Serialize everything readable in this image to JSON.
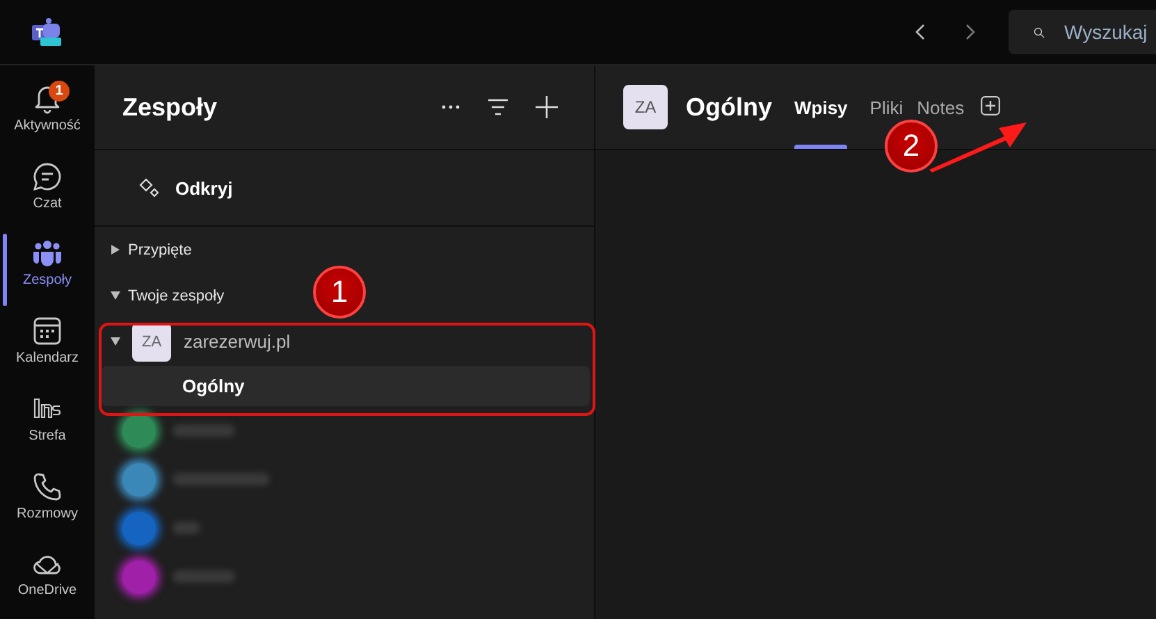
{
  "top_bar": {
    "search": {
      "placeholder": "Wyszukaj"
    }
  },
  "rail": [
    {
      "kind": "bell",
      "label": "Aktywność",
      "selected": false,
      "badge": "1"
    },
    {
      "kind": "chat",
      "label": "Czat",
      "selected": false
    },
    {
      "kind": "teams",
      "label": "Zespoły",
      "selected": true
    },
    {
      "kind": "calendar",
      "label": "Kalendarz",
      "selected": false
    },
    {
      "kind": "app",
      "label": "Strefa",
      "selected": false
    },
    {
      "kind": "phone",
      "label": "Rozmowy",
      "selected": false
    },
    {
      "kind": "cloud",
      "label": "OneDrive",
      "selected": false
    }
  ],
  "teams_pane": {
    "title": "Zespoły",
    "discover": "Odkryj",
    "sections": [
      {
        "label": "Przypięte",
        "expanded": false
      },
      {
        "label": "Twoje zespoły",
        "expanded": true,
        "children": [
          {
            "avatar": "ZA",
            "name": "zarezerwuj.pl",
            "expanded": true,
            "children": [
              {
                "name": "Ogólny",
                "selected": true
              }
            ]
          }
        ]
      }
    ],
    "blurred_teams": [
      {
        "color": "#2e8b57"
      },
      {
        "color": "#3a87b8"
      },
      {
        "color": "#1565c0"
      },
      {
        "color": "#a020a8"
      }
    ]
  },
  "channel": {
    "avatar": "ZA",
    "title": "Ogólny",
    "tabs": [
      {
        "label": "Wpisy",
        "selected": true
      },
      {
        "label": "Pliki",
        "selected": false
      },
      {
        "label": "Notes",
        "selected": false
      }
    ]
  },
  "annotations": [
    {
      "label": "1"
    },
    {
      "label": "2"
    }
  ]
}
